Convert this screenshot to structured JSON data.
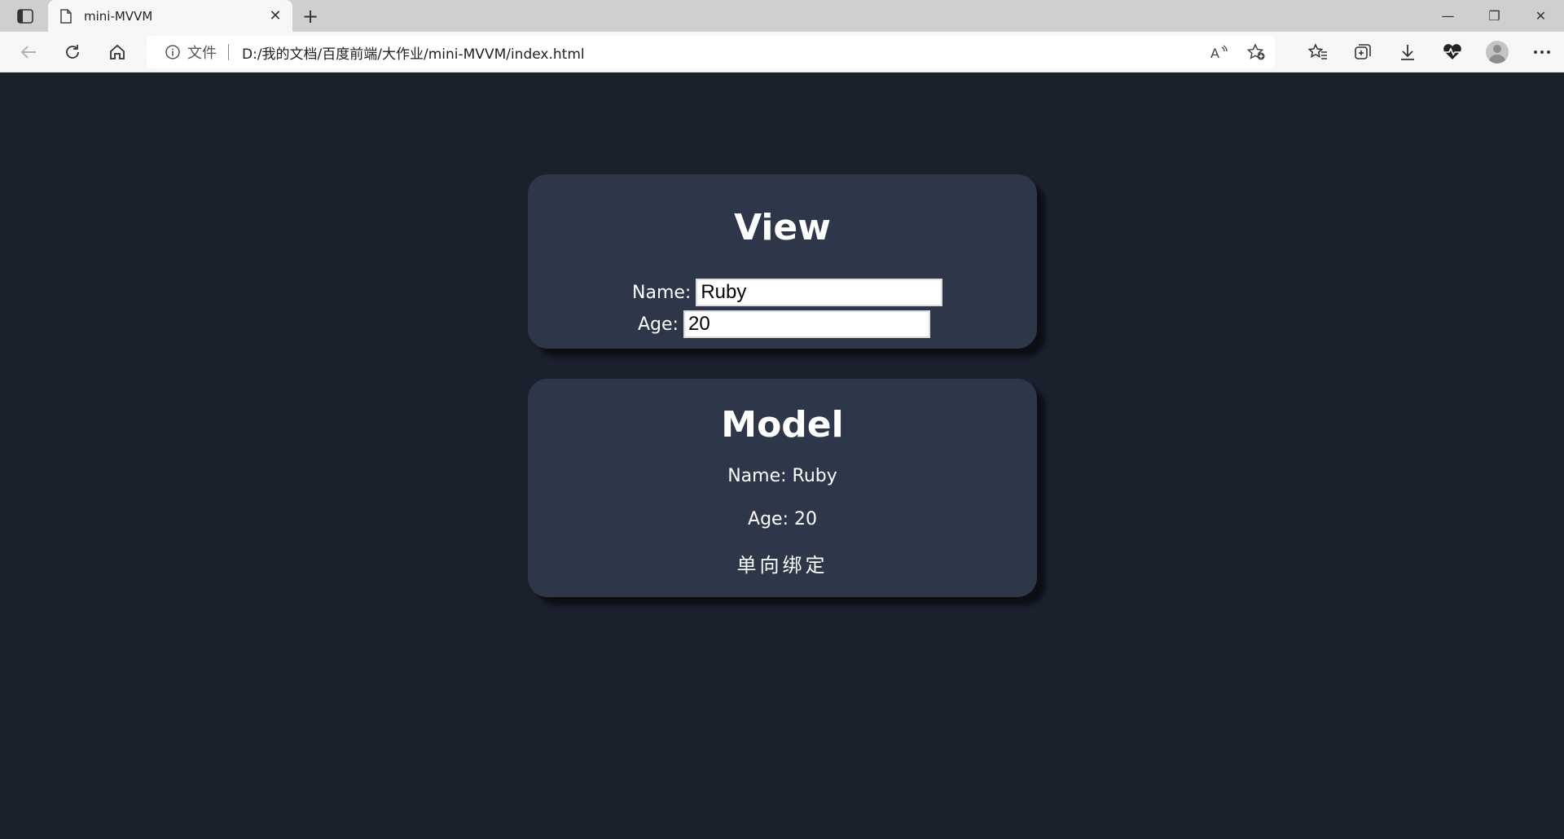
{
  "browser": {
    "tab_title": "mini-MVVM",
    "tab_close": "✕",
    "new_tab": "+",
    "address": {
      "security_label": "文件",
      "url": "D:/我的文档/百度前端/大作业/mini-MVVM/index.html"
    },
    "window": {
      "minimize": "—",
      "maximize": "❐",
      "close": "✕"
    }
  },
  "view": {
    "title": "View",
    "name_label": "Name:",
    "name_value": "Ruby",
    "age_label": "Age:",
    "age_value": "20"
  },
  "model": {
    "title": "Model",
    "name_line": "Name: Ruby",
    "age_line": "Age: 20",
    "binding_text": "单向绑定"
  }
}
